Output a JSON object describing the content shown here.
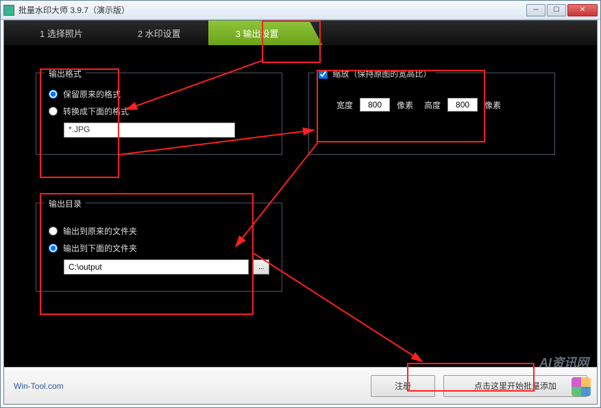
{
  "title": "批量水印大师 3.9.7（演示版）",
  "tabs": {
    "t1": "1 选择照片",
    "t2": "2 水印设置",
    "t3": "3 输出设置"
  },
  "format": {
    "legend": "输出格式",
    "keep": "保留原来的格式",
    "convert": "转换成下面的格式",
    "ext": "*.JPG"
  },
  "scale": {
    "legend": "缩放（保持原图的宽高比）",
    "widthLabel": "宽度",
    "width": "800",
    "heightLabel": "高度",
    "height": "800",
    "unit": "像素"
  },
  "outdir": {
    "legend": "输出目录",
    "orig": "输出到原来的文件夹",
    "to": "输出到下面的文件夹",
    "path": "C:\\output",
    "browse": "..."
  },
  "footer": {
    "link": "Win-Tool.com",
    "register": "注册",
    "start": "点击这里开始批量添加"
  },
  "watermark": "AI资讯网"
}
